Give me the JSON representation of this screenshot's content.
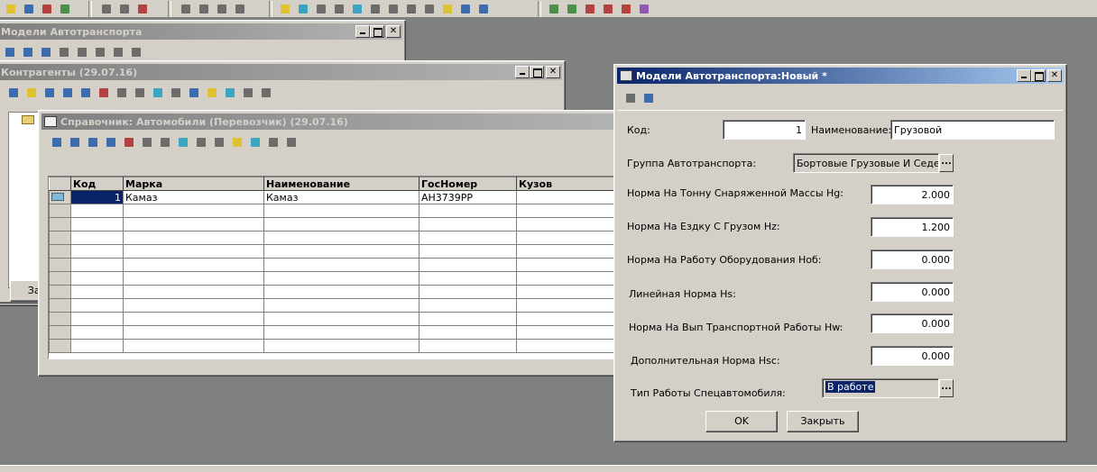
{
  "colors": {
    "active_title": "#0a246a",
    "inactive_title": "#808080",
    "face": "#d4d0c8",
    "desktop": "#808080",
    "selection": "#0a246a"
  },
  "main_toolbar": {
    "icons": [
      "open-icon",
      "catalog-icon",
      "journal-icon",
      "help-pointer-icon",
      "list-icon",
      "clock-icon",
      "db-icon",
      "report-icon",
      "table-icon",
      "form-icon",
      "module-icon",
      "doc-icon",
      "plus-icon",
      "minus-icon",
      "insert-icon",
      "grid-icon",
      "pen-icon",
      "run-icon",
      "calc-icon",
      "folder-icon",
      "globe-icon",
      "tree-icon",
      "tools-icon",
      "users-icon",
      "edit-icon",
      "config-icon"
    ]
  },
  "win_models": {
    "title": "Модели Автотранспорта"
  },
  "win_contractors": {
    "title": "Контрагенты (29.07.16)",
    "close_partial": "Зак"
  },
  "win_cars": {
    "title": "Справочник: Автомобили (Перевозчик) (29.07.16)",
    "columns": [
      "Код",
      "Марка",
      "Наименование",
      "ГосНомер",
      "Кузов"
    ],
    "rows": [
      {
        "code": "1",
        "brand": "Камаз",
        "name": "Камаз",
        "plate": "АН3739РР",
        "body": ""
      }
    ]
  },
  "dialog": {
    "title": "Модели Автотранспорта:Новый *",
    "code_label": "Код:",
    "code_value": "1",
    "name_label": "Наименование:",
    "name_value": "Грузовой",
    "group_label": "Группа Автотранспорта:",
    "group_value": "Бортовые Грузовые И Седелы",
    "norms": [
      {
        "label": "Норма На Тонну Снаряженной Массы Hg:",
        "value": "2.000"
      },
      {
        "label": "Норма На Ездку С Грузом Hz:",
        "value": "1.200"
      },
      {
        "label": "Норма На Работу Оборудования Hоб:",
        "value": "0.000"
      },
      {
        "label": "Линейная Норма Hs:",
        "value": "0.000"
      },
      {
        "label": "Норма На Вып Транспортной Работы Hw:",
        "value": "0.000"
      },
      {
        "label": "Дополнительная Норма Hsc:",
        "value": "0.000"
      }
    ],
    "work_type_label": "Тип Работы Спецавтомобиля:",
    "work_type_value": "В работе",
    "ok_label": "OK",
    "close_label": "Закрыть",
    "browse_label": "..."
  }
}
